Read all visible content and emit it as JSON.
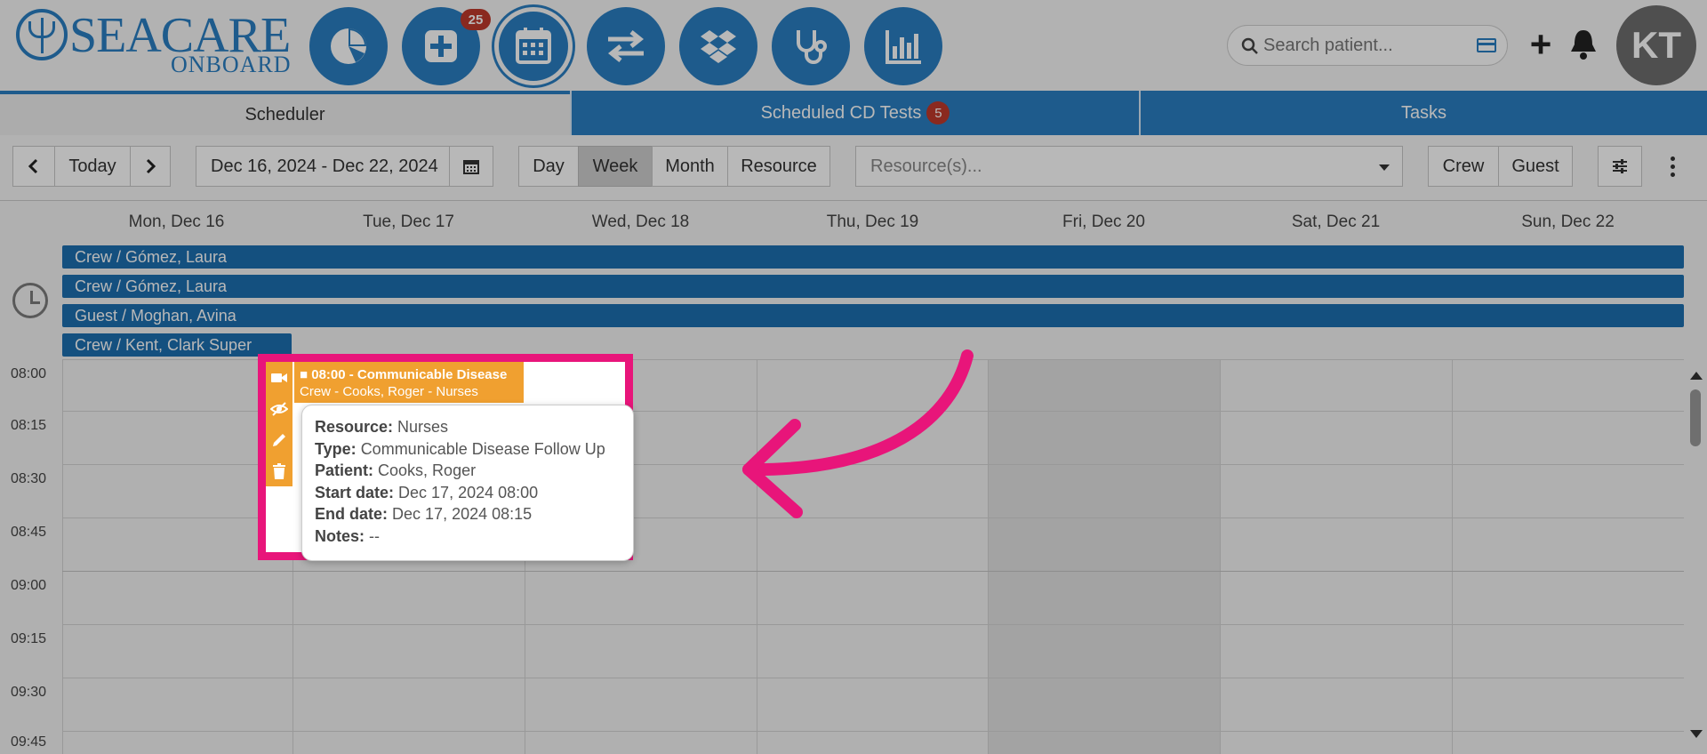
{
  "header": {
    "logo_text_main": "SEACARE",
    "logo_text_sub": "ONBOARD",
    "nav": [
      {
        "name": "dashboard",
        "icon": "pie-chart-icon"
      },
      {
        "name": "medical",
        "icon": "plus-square-icon",
        "badge": "25"
      },
      {
        "name": "scheduler",
        "icon": "calendar-icon"
      },
      {
        "name": "transfers",
        "icon": "arrows-exchange-icon"
      },
      {
        "name": "inventory",
        "icon": "dropbox-icon"
      },
      {
        "name": "clinical",
        "icon": "stethoscope-icon"
      },
      {
        "name": "reports",
        "icon": "bar-chart-icon"
      }
    ],
    "search_placeholder": "Search patient...",
    "add_label": "+",
    "avatar_initials": "KT",
    "accent": "#2a7fc2"
  },
  "tabs": [
    {
      "label": "Scheduler",
      "selected": true
    },
    {
      "label": "Scheduled CD Tests",
      "badge": "5"
    },
    {
      "label": "Tasks"
    }
  ],
  "toolbar": {
    "today_label": "Today",
    "date_range": "Dec 16, 2024 - Dec 22, 2024",
    "views": [
      "Day",
      "Week",
      "Month",
      "Resource"
    ],
    "selected_view": "Week",
    "resource_placeholder": "Resource(s)...",
    "filters": [
      "Crew",
      "Guest"
    ]
  },
  "calendar": {
    "days": [
      "Mon, Dec 16",
      "Tue, Dec 17",
      "Wed, Dec 18",
      "Thu, Dec 19",
      "Fri, Dec 20",
      "Sat, Dec 21",
      "Sun, Dec 22"
    ],
    "allday_events": [
      {
        "label": "Crew / Gómez, Laura"
      },
      {
        "label": "Crew / Gómez, Laura"
      },
      {
        "label": "Guest / Moghan, Avina"
      },
      {
        "label": "Crew / Kent, Clark Super"
      }
    ],
    "times": [
      "08:00",
      "08:15",
      "08:30",
      "08:45",
      "09:00",
      "09:15",
      "09:30",
      "09:45"
    ],
    "event": {
      "line1": "08:00 - Communicable Disease",
      "line2": "Crew - Cooks, Roger - Nurses",
      "color": "#f0a030"
    },
    "tooltip": {
      "resource_key": "Resource:",
      "resource": "Nurses",
      "type_key": "Type:",
      "type": "Communicable Disease Follow Up",
      "patient_key": "Patient:",
      "patient": "Cooks, Roger",
      "start_key": "Start date:",
      "start": "Dec 17, 2024 08:00",
      "end_key": "End date:",
      "end": "Dec 17, 2024 08:15",
      "notes_key": "Notes:",
      "notes": "--"
    },
    "highlight_color": "#e8157a"
  }
}
